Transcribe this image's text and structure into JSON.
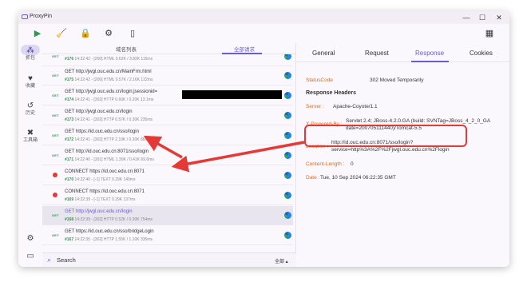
{
  "app": {
    "title": "ProxyPin"
  },
  "window_controls": {
    "minimize": "—",
    "maximize": "☐",
    "close": "✕"
  },
  "toolbar": {
    "play": "▶",
    "clean": "🧹",
    "lock": "🔒",
    "settings": "⚙",
    "mobile": "▯",
    "layout": "▦"
  },
  "sidebar": {
    "items": [
      {
        "label": "抓包",
        "icon": "⁂"
      },
      {
        "label": "收藏",
        "icon": "♥"
      },
      {
        "label": "历史",
        "icon": "↺"
      },
      {
        "label": "工具箱",
        "icon": "✖"
      }
    ],
    "bottom_icons": [
      "⚙",
      "▭"
    ]
  },
  "list": {
    "tabs": [
      "域名列表",
      "全部请求"
    ],
    "rows": [
      {
        "badge": "GET",
        "request": "",
        "id": "#176",
        "meta": " 14:22:42 - [200]  HTML 0.62K / 3.83K  115ms"
      },
      {
        "badge": "GET",
        "request": "GET http://jwgl.ouc.edu.cn/MainFrm.html",
        "id": "#175",
        "meta": " 14:22:42 - [200]  HTML 0.57K / 2.16K  122ms"
      },
      {
        "badge": "GET",
        "request": "GET http://jwgl.ouc.edu.cn/login;jsessionid=",
        "id": "#174",
        "meta": " 14:22:41 - [302]  HTTP 0.60K / 0.20K  13.1ms"
      },
      {
        "badge": "GET",
        "request": "GET http://jwgl.ouc.edu.cn/login",
        "id": "#173",
        "meta": " 14:22:41 - [302]  HTTP 0.57K / 0.30K  235ms"
      },
      {
        "badge": "GET",
        "request": "GET https://id.ouc.edu.cn/sso/login",
        "id": "#172",
        "meta": " 14:22:41 - [302]  HTTP 2.19K / 0.30K  86ms"
      },
      {
        "badge": "GET",
        "request": "GET http://id.ouc.edu.cn:8071/sso/login",
        "id": "#171",
        "meta": " 14:22:40 - [301]  HTML 1.30K / 0.41K  69.6ms"
      },
      {
        "badge": "ERR",
        "request": "CONNECT https://id.ouc.edu.cn:8071",
        "id": "#170",
        "meta": " 14:22:40 - [-1]  TEXT 0.29K  149ms"
      },
      {
        "badge": "ERR",
        "request": "CONNECT https://id.ouc.edu.cn:8071",
        "id": "#169",
        "meta": " 14:22:39 - [-1]  TEXT 0.29K  137ms"
      },
      {
        "badge": "GET",
        "request": "GET http://jwgl.ouc.edu.cn/login",
        "id": "#168",
        "meta": " 14:22:39 - [302]  HTTP 0.52K / 0.30K  754ms"
      },
      {
        "badge": "GET",
        "request": "GET https://id.ouc.edu.cn/sso/bridgeLogin",
        "id": "#167",
        "meta": " 14:22:35 - [302]  HTTP 1.55K / 1.10K  335ms"
      }
    ]
  },
  "search": {
    "placeholder": "Search",
    "filter": "全部 ▴"
  },
  "detail": {
    "tabs": [
      "General",
      "Request",
      "Response",
      "Cookies"
    ],
    "status_label": "StatusCode",
    "status_value": "302  Moved Temporarily",
    "headers_title": "Response Headers",
    "server_key": "Server :",
    "server_val": "Apache-Coyote/1.1",
    "xpb_key": "X-Powered-By :",
    "xpb_val1": "Servlet 2.4; JBoss-4.2.0.GA (build: SVNTag=JBoss_4_2_0_GA",
    "xpb_val2": "date=200705111440)/Tomcat-5.5",
    "loc_key": "Location :",
    "loc_val1": "http://id.ouc.edu.cn:8071/sso/login?",
    "loc_val2": "service=http%3A%2F%2Fjwgl.ouc.edu.cn%2Flogin",
    "cl_key": "Content-Length :",
    "cl_val": "0",
    "date_key": "Date :",
    "date_val": "Tue, 10 Sep 2024 06:22:35 GMT"
  },
  "annotation_color": "#e53935",
  "accent_color": "#6a5bd6"
}
